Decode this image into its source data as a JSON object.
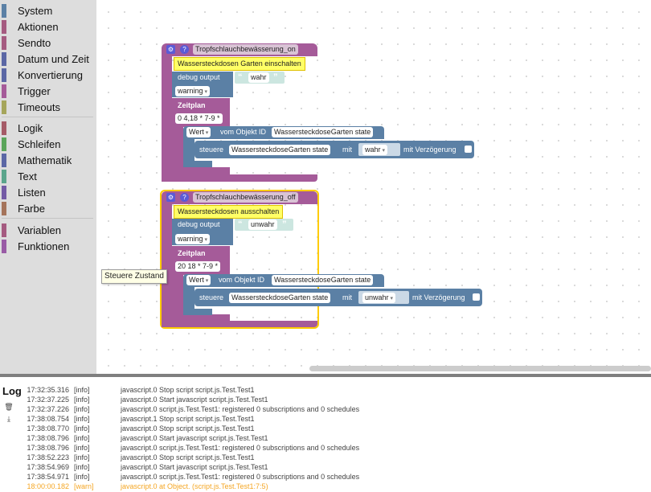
{
  "toolbox": {
    "categories": [
      {
        "label": "System",
        "color": "#5b80a5"
      },
      {
        "label": "Aktionen",
        "color": "#a55b80"
      },
      {
        "label": "Sendto",
        "color": "#a55b80"
      },
      {
        "label": "Datum und Zeit",
        "color": "#5b67a5"
      },
      {
        "label": "Konvertierung",
        "color": "#5b67a5"
      },
      {
        "label": "Trigger",
        "color": "#a55b99"
      },
      {
        "label": "Timeouts",
        "color": "#a5a55b"
      },
      {
        "label": "Logik",
        "color": "#a55b67"
      },
      {
        "label": "Schleifen",
        "color": "#5ba55b"
      },
      {
        "label": "Mathematik",
        "color": "#5b67a5"
      },
      {
        "label": "Text",
        "color": "#5ba58c"
      },
      {
        "label": "Listen",
        "color": "#745ba5"
      },
      {
        "label": "Farbe",
        "color": "#a5745b"
      },
      {
        "label": "Variablen",
        "color": "#a55b80"
      },
      {
        "label": "Funktionen",
        "color": "#995ba5"
      }
    ]
  },
  "tooltip": "Steuere Zustand",
  "blocks": [
    {
      "title": "Tropfschlauchbewässerung_on",
      "comment": "Wassersteckdosen Garten einschalten",
      "debug_label": "debug output",
      "debug_value": "wahr",
      "log_level": "warning",
      "schedule_label": "Zeitplan",
      "cron": "0 4,18 * 7-9 *",
      "value_label": "Wert",
      "from_object_label": "vom Objekt ID",
      "object_id": "WassersteckdoseGarten state",
      "control_label": "steuere",
      "control_object": "WassersteckdoseGarten state",
      "with_label": "mit",
      "control_value": "wahr",
      "delay_label": "mit Verzögerung"
    },
    {
      "title": "Tropfschlauchbewässerung_off",
      "comment": "Wassersteckdosen ausschalten",
      "debug_label": "debug output",
      "debug_value": "unwahr",
      "log_level": "warning",
      "schedule_label": "Zeitplan",
      "cron": "20 18 * 7-9 *",
      "value_label": "Wert",
      "from_object_label": "vom Objekt ID",
      "object_id": "WassersteckdoseGarten state",
      "control_label": "steuere",
      "control_object": "WassersteckdoseGarten state",
      "with_label": "mit",
      "control_value": "unwahr",
      "delay_label": "mit Verzögerung"
    }
  ],
  "log": {
    "title": "Log",
    "tools": [
      {
        "icon": "trash-icon",
        "glyph": "🗑"
      },
      {
        "icon": "download-icon",
        "glyph": "⤓"
      }
    ],
    "rows": [
      {
        "time": "17:32:35.316",
        "level": "[info]",
        "msg": "javascript.0 Stop script script.js.Test.Test1"
      },
      {
        "time": "17:32:37.225",
        "level": "[info]",
        "msg": "javascript.0 Start javascript script.js.Test.Test1"
      },
      {
        "time": "17:32:37.226",
        "level": "[info]",
        "msg": "javascript.0 script.js.Test.Test1: registered 0 subscriptions and 0 schedules"
      },
      {
        "time": "17:38:08.754",
        "level": "[info]",
        "msg": "javascript.1 Stop script script.js.Test.Test1"
      },
      {
        "time": "17:38:08.770",
        "level": "[info]",
        "msg": "javascript.0 Stop script script.js.Test.Test1"
      },
      {
        "time": "17:38:08.796",
        "level": "[info]",
        "msg": "javascript.0 Start javascript script.js.Test.Test1"
      },
      {
        "time": "17:38:08.796",
        "level": "[info]",
        "msg": "javascript.0 script.js.Test.Test1: registered 0 subscriptions and 0 schedules"
      },
      {
        "time": "17:38:52.223",
        "level": "[info]",
        "msg": "javascript.0 Stop script script.js.Test.Test1"
      },
      {
        "time": "17:38:54.969",
        "level": "[info]",
        "msg": "javascript.0 Start javascript script.js.Test.Test1"
      },
      {
        "time": "17:38:54.971",
        "level": "[info]",
        "msg": "javascript.0 script.js.Test.Test1: registered 0 subscriptions and 0 schedules"
      },
      {
        "time": "18:00:00.182",
        "level": "[warn]",
        "msg": "javascript.0 at Object. (script.js.Test.Test1:7:5)"
      }
    ]
  },
  "colors": {
    "trigger": "#a55b99",
    "action": "#5b80a5",
    "selected_border": "#ffcc00",
    "comment": "#ffff66",
    "warn": "#f5a623"
  }
}
